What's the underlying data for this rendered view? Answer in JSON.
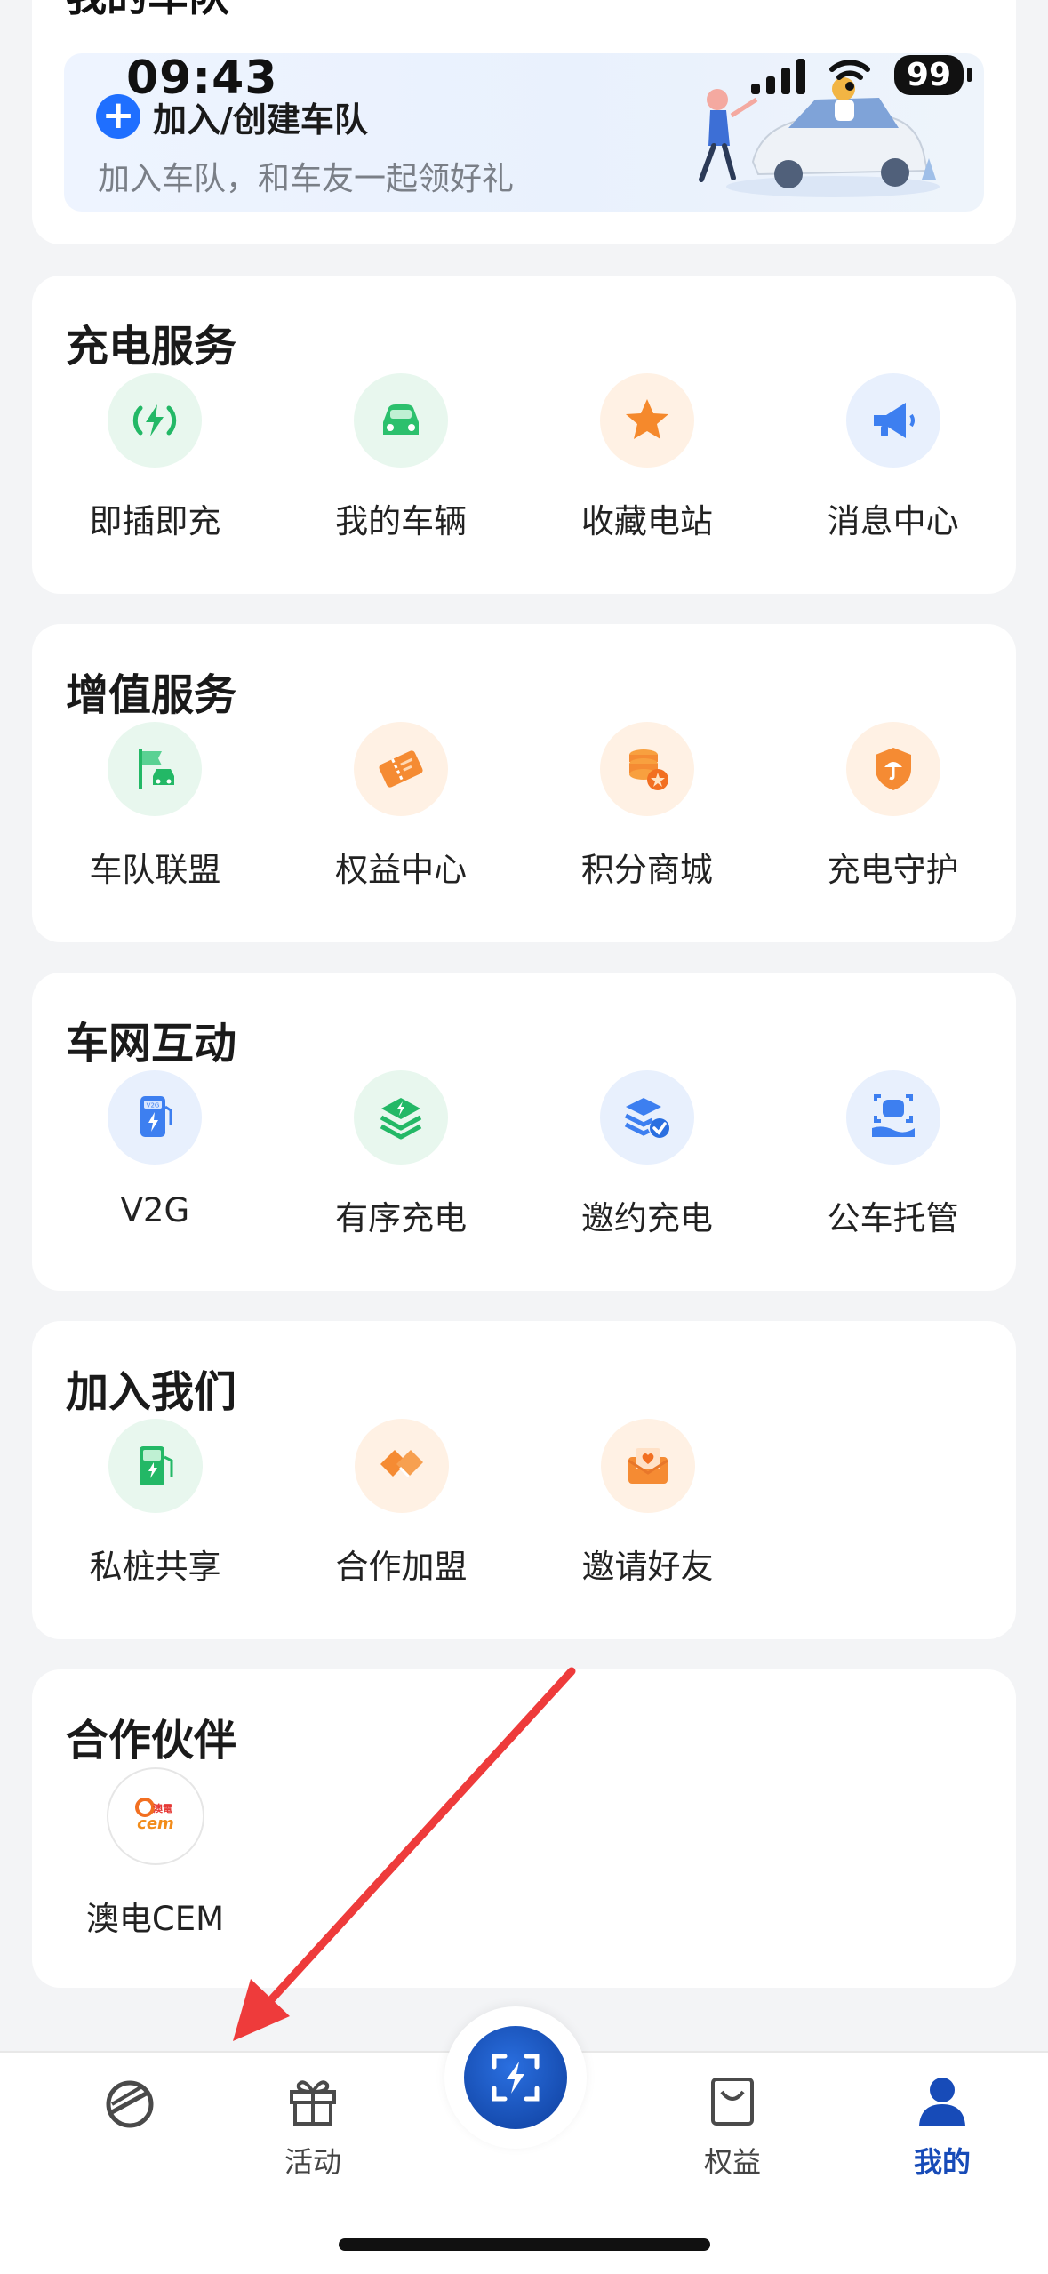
{
  "status_bar": {
    "time": "09:43",
    "battery": "99"
  },
  "fleet": {
    "section_title_partial": "我的车队",
    "join_title": "加入/创建车队",
    "join_subtitle": "加入车队，和车友一起领好礼"
  },
  "sections": [
    {
      "title": "充电服务",
      "items": [
        {
          "label": "即插即充",
          "icon": "plug-charge-icon"
        },
        {
          "label": "我的车辆",
          "icon": "car-icon"
        },
        {
          "label": "收藏电站",
          "icon": "star-icon"
        },
        {
          "label": "消息中心",
          "icon": "megaphone-icon"
        }
      ]
    },
    {
      "title": "增值服务",
      "items": [
        {
          "label": "车队联盟",
          "icon": "fleet-flag-icon"
        },
        {
          "label": "权益中心",
          "icon": "ticket-icon"
        },
        {
          "label": "积分商城",
          "icon": "coins-icon"
        },
        {
          "label": "充电守护",
          "icon": "shield-umbrella-icon"
        }
      ]
    },
    {
      "title": "车网互动",
      "items": [
        {
          "label": "V2G",
          "icon": "v2g-station-icon"
        },
        {
          "label": "有序充电",
          "icon": "layers-icon"
        },
        {
          "label": "邀约充电",
          "icon": "invite-charge-icon"
        },
        {
          "label": "公车托管",
          "icon": "face-scan-icon"
        }
      ]
    },
    {
      "title": "加入我们",
      "items": [
        {
          "label": "私桩共享",
          "icon": "private-pile-icon"
        },
        {
          "label": "合作加盟",
          "icon": "handshake-icon"
        },
        {
          "label": "邀请好友",
          "icon": "envelope-heart-icon"
        }
      ]
    },
    {
      "title": "合作伙伴",
      "items": [
        {
          "label": "澳电CEM",
          "icon": "cem-logo",
          "logo_text": "澳電 cem"
        }
      ]
    }
  ],
  "bottom_nav": {
    "items": [
      {
        "label": "",
        "icon": "planet-icon"
      },
      {
        "label": "活动",
        "icon": "gift-icon"
      },
      {
        "label": "权益",
        "icon": "bag-icon"
      },
      {
        "label": "我的",
        "icon": "user-icon",
        "active": true
      }
    ],
    "center": {
      "icon": "scan-charge-icon"
    }
  },
  "colors": {
    "accent": "#1f6fff",
    "nav_active": "#174bb8",
    "arrow": "#ee3b3b"
  }
}
